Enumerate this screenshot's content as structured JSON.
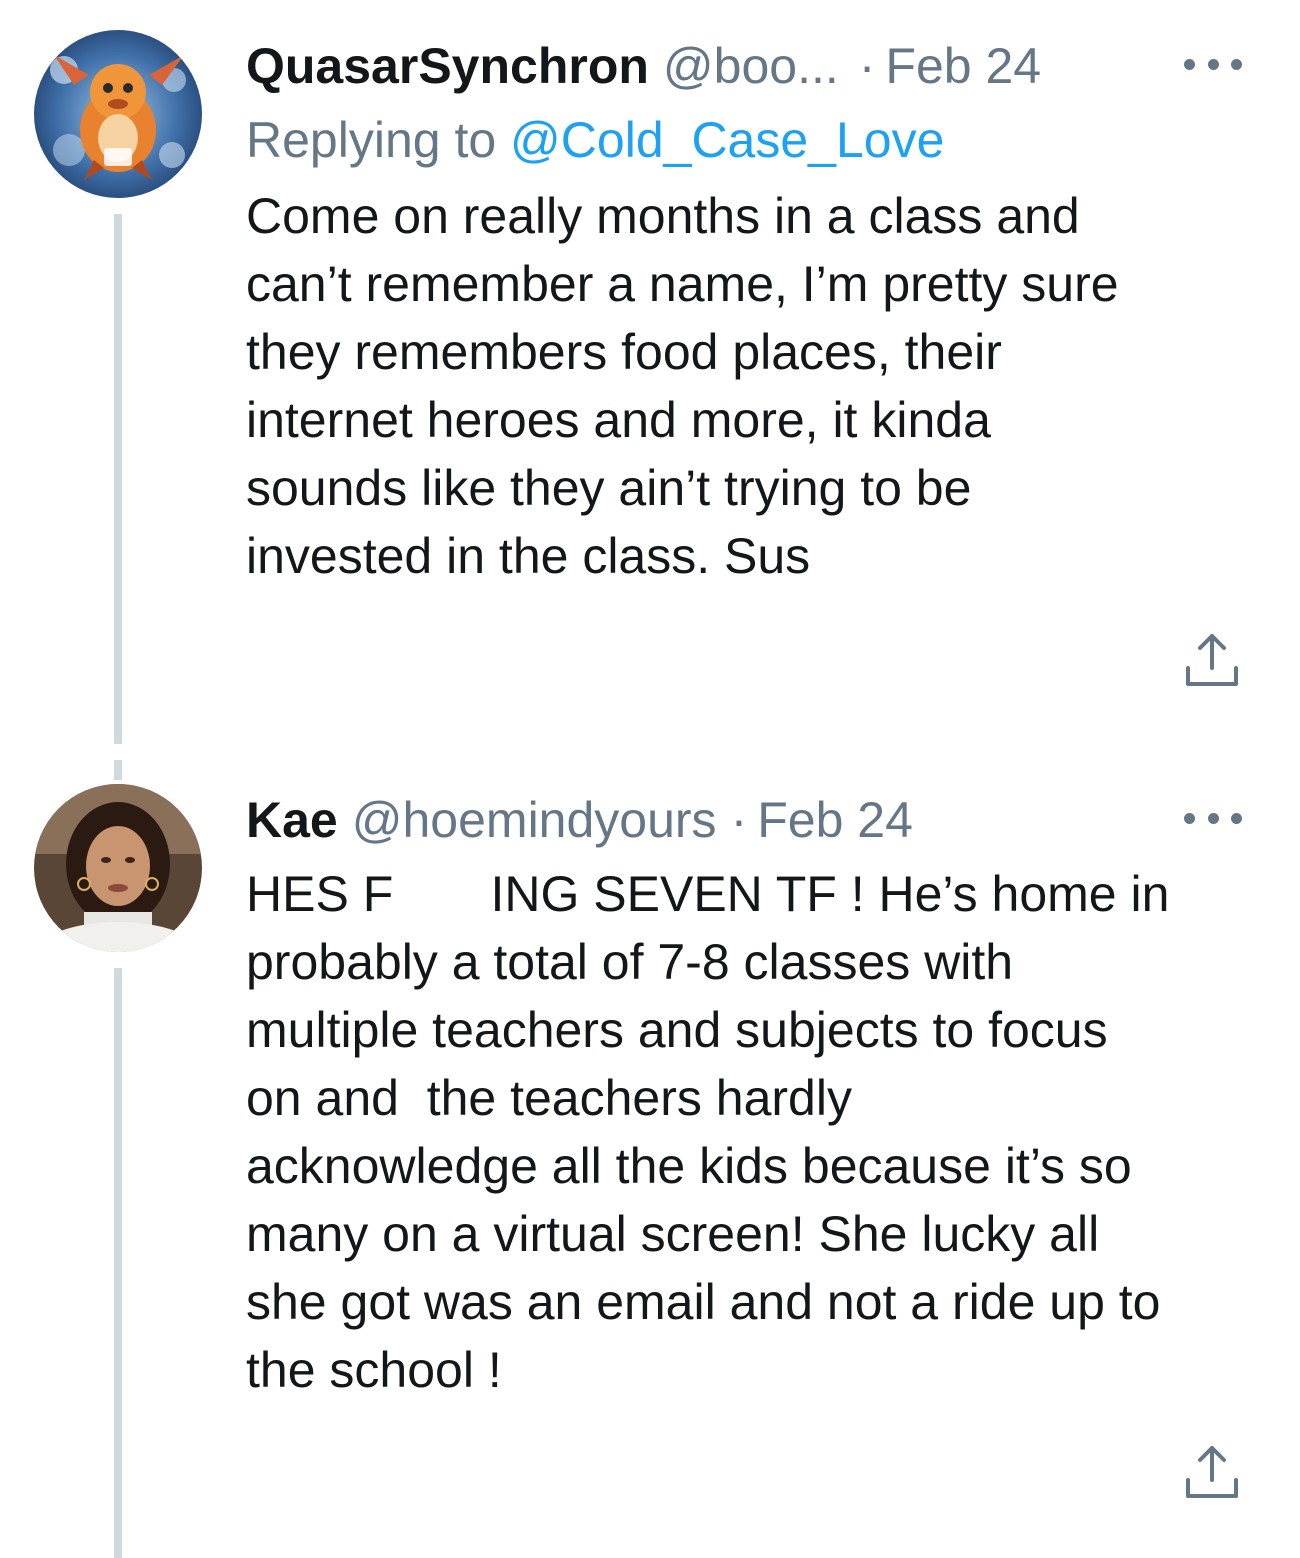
{
  "tweets": [
    {
      "name": "QuasarSynchron",
      "handle": "@boo...",
      "separator": "·",
      "date": "Feb 24",
      "replying_prefix": "Replying to ",
      "replying_to": "@Cold_Case_Love",
      "text_lines": [
        "Come on really months in a class and",
        "can’t remember a name, I’m pretty sure",
        "they remembers food places, their",
        "internet heroes and more, it kinda",
        "sounds like they ain’t trying to be",
        "invested in the class. Sus"
      ],
      "avatar_icon": "dragon-avatar-icon",
      "more_icon": "more-options-icon",
      "share_icon": "share-icon"
    },
    {
      "name": "Kae",
      "handle": "@hoemindyours",
      "separator": "·",
      "date": "Feb 24",
      "text_lines": [
        "HES F       ING SEVEN TF ! He’s home in",
        "probably a total of 7-8 classes with",
        "multiple teachers and subjects to focus",
        "on and  the teachers hardly",
        "acknowledge all the kids because it’s so",
        "many on a virtual screen! She lucky all",
        "she got was an email and not a ride up to",
        "the school !"
      ],
      "avatar_icon": "person-avatar-icon",
      "more_icon": "more-options-icon",
      "share_icon": "share-icon"
    }
  ],
  "colors": {
    "text_primary": "#14171a",
    "text_secondary": "#657786",
    "link": "#1da1f2",
    "thread_line": "#cfd9de"
  }
}
